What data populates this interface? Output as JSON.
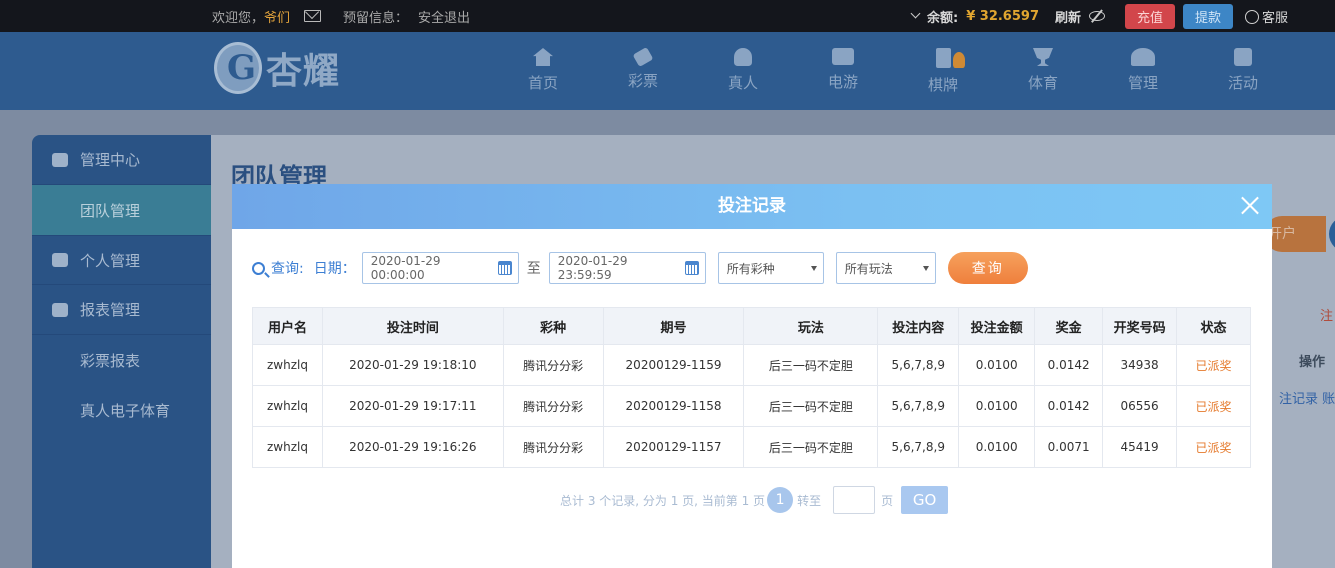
{
  "topbar": {
    "welcome": "欢迎您，",
    "username": "爷们",
    "notice_label": "预留信息：",
    "logout": "安全退出",
    "balance_label": "余额:",
    "balance_value": "¥ 32.6597",
    "refresh": "刷新",
    "recharge": "充值",
    "withdraw": "提款",
    "customer_service": "客服"
  },
  "header": {
    "logo_text": "杏耀",
    "nav": [
      {
        "label": "首页",
        "icon": "home-icon"
      },
      {
        "label": "彩票",
        "icon": "ticket-icon"
      },
      {
        "label": "真人",
        "icon": "dealer-icon"
      },
      {
        "label": "电游",
        "icon": "gamepad-icon"
      },
      {
        "label": "棋牌",
        "icon": "card-icon"
      },
      {
        "label": "体育",
        "icon": "trophy-icon"
      },
      {
        "label": "管理",
        "icon": "users-icon"
      },
      {
        "label": "活动",
        "icon": "gift-icon"
      }
    ]
  },
  "sidebar": {
    "items": [
      {
        "label": "管理中心",
        "type": "head",
        "icon": "users-icon"
      },
      {
        "label": "团队管理",
        "type": "sub",
        "active": true
      },
      {
        "label": "个人管理",
        "type": "head",
        "icon": "user-icon"
      },
      {
        "label": "报表管理",
        "type": "head",
        "icon": "report-icon"
      },
      {
        "label": "彩票报表",
        "type": "sub"
      },
      {
        "label": "真人电子体育",
        "type": "sub"
      }
    ]
  },
  "content": {
    "title": "团队管理",
    "open_btn_partial": "开户",
    "note_partial": "注",
    "op_header": "操作",
    "row_links_partial": "注记录 账变"
  },
  "modal": {
    "title": "投注记录",
    "filter": {
      "query_label": "查询:",
      "date_label": "日期：",
      "date_from": "2020-01-29 00:00:00",
      "to_label": "至",
      "date_to": "2020-01-29 23:59:59",
      "lottery_select": "所有彩种",
      "play_select": "所有玩法",
      "query_button": "查询"
    },
    "table": {
      "columns": [
        "用户名",
        "投注时间",
        "彩种",
        "期号",
        "玩法",
        "投注内容",
        "投注金额",
        "奖金",
        "开奖号码",
        "状态"
      ],
      "rows": [
        [
          "zwhzlq",
          "2020-01-29 19:18:10",
          "腾讯分分彩",
          "20200129-1159",
          "后三一码不定胆",
          "5,6,7,8,9",
          "0.0100",
          "0.0142",
          "34938",
          "已派奖"
        ],
        [
          "zwhzlq",
          "2020-01-29 19:17:11",
          "腾讯分分彩",
          "20200129-1158",
          "后三一码不定胆",
          "5,6,7,8,9",
          "0.0100",
          "0.0142",
          "06556",
          "已派奖"
        ],
        [
          "zwhzlq",
          "2020-01-29 19:16:26",
          "腾讯分分彩",
          "20200129-1157",
          "后三一码不定胆",
          "5,6,7,8,9",
          "0.0100",
          "0.0071",
          "45419",
          "已派奖"
        ]
      ]
    },
    "pager": {
      "summary": "总计 3 个记录, 分为 1 页, 当前第 1 页",
      "current_page": "1",
      "goto_label": "转至",
      "page_unit": "页",
      "go_button": "GO"
    }
  },
  "colors": {
    "header_bg": "#2e5b8f",
    "accent_orange": "#ef7f3c",
    "status_paid": "#e57a2d",
    "modal_head": "#7bc0f2"
  }
}
